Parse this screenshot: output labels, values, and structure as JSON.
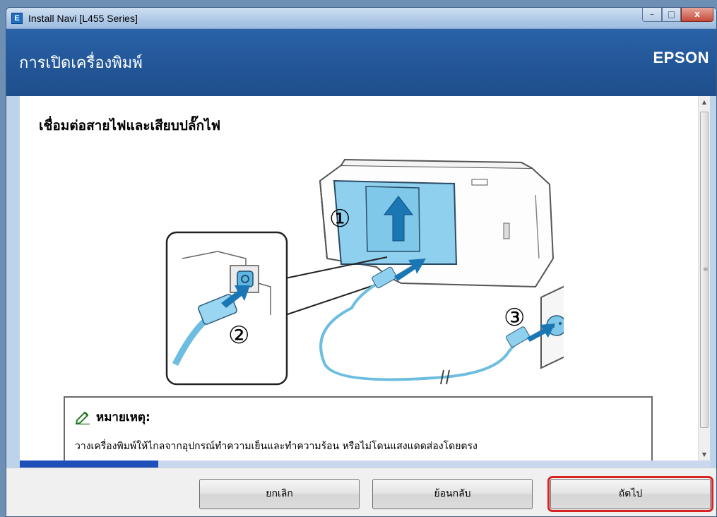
{
  "window": {
    "title": "Install Navi [L455 Series]",
    "app_icon_letter": "E",
    "controls": {
      "minimize": "–",
      "maximize": "□",
      "close": "x"
    }
  },
  "header": {
    "title": "การเปิดเครื่องพิมพ์",
    "brand": "EPSON"
  },
  "content": {
    "section_title": "เชื่อมต่อสายไฟและเสียบปลั๊กไฟ",
    "illustration": {
      "step_labels": [
        "①",
        "②",
        "③"
      ]
    },
    "note": {
      "title": "หมายเหตุ:",
      "text": "วางเครื่องพิมพ์ให้ไกลจากอุปกรณ์ทำความเย็นและทำความร้อน หรือไม่โดนแสงแดดส่องโดยตรง"
    }
  },
  "progress": {
    "value": 0.2
  },
  "footer": {
    "cancel_label": "ยกเลิก",
    "back_label": "ย้อนกลับ",
    "next_label": "ถัดไป"
  },
  "colors": {
    "header_blue": "#225697",
    "progress_fill": "#1e4fb8",
    "highlight_red": "#d62424",
    "illustration_blue": "#7fc8ea"
  },
  "icons": {
    "app": "epson-app-icon",
    "note": "pencil-icon",
    "scroll_up": "chevron-up-icon",
    "scroll_down": "chevron-down-icon"
  }
}
